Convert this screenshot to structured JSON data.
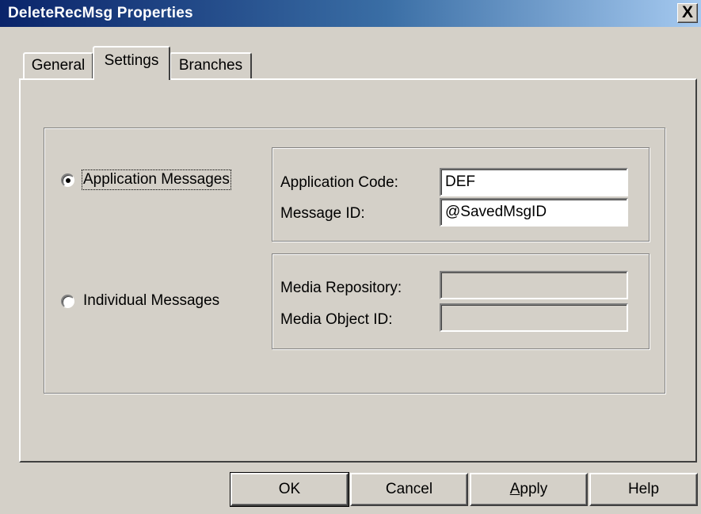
{
  "window": {
    "title": "DeleteRecMsg Properties",
    "close_glyph": "X"
  },
  "tabs": [
    {
      "label": "General",
      "selected": false
    },
    {
      "label": "Settings",
      "selected": true
    },
    {
      "label": "Branches",
      "selected": false
    }
  ],
  "settings": {
    "application_messages": {
      "label": "Application Messages",
      "checked": true,
      "fields": {
        "application_code_label": "Application Code:",
        "application_code_value": "DEF",
        "message_id_label": "Message ID:",
        "message_id_value": "@SavedMsgID"
      }
    },
    "individual_messages": {
      "label": "Individual Messages",
      "checked": false,
      "fields": {
        "media_repository_label": "Media Repository:",
        "media_repository_value": "",
        "media_object_id_label": "Media Object ID:",
        "media_object_id_value": ""
      }
    }
  },
  "buttons": {
    "ok": "OK",
    "cancel": "Cancel",
    "apply_prefix": "A",
    "apply_rest": "pply",
    "help": "Help"
  },
  "icons": {
    "close": "close-icon",
    "radio": "radio-button-icon"
  },
  "colors": {
    "title_start": "#0a246a",
    "title_end": "#a6caf0",
    "face": "#d4d0c8"
  }
}
